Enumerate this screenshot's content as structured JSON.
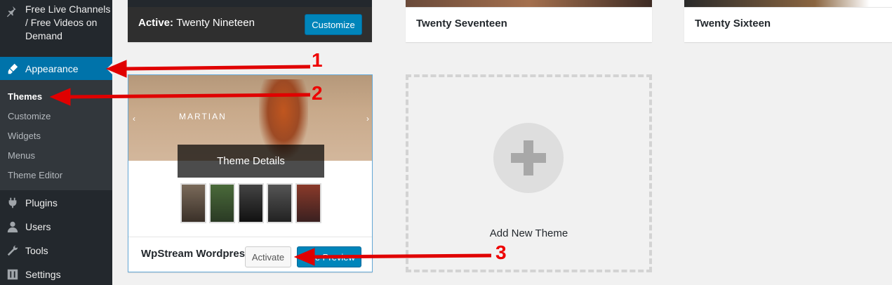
{
  "sidebar": {
    "items": [
      {
        "label": "Free Live Channels / Free Videos on Demand",
        "icon": "pushpin-icon"
      },
      {
        "label": "Appearance",
        "icon": "paintbrush-icon"
      },
      {
        "label": "Plugins",
        "icon": "plug-icon"
      },
      {
        "label": "Users",
        "icon": "user-icon"
      },
      {
        "label": "Tools",
        "icon": "wrench-icon"
      },
      {
        "label": "Settings",
        "icon": "settings-icon"
      }
    ],
    "submenu": [
      "Themes",
      "Customize",
      "Widgets",
      "Menus",
      "Theme Editor"
    ]
  },
  "themes": {
    "active": {
      "prefix": "Active:",
      "name": "Twenty Nineteen",
      "button": "Customize"
    },
    "twenty_seventeen": "Twenty Seventeen",
    "twenty_sixteen": "Twenty Sixteen",
    "wpstream": {
      "name": "WpStream Wordpress",
      "hero_title": "MARTIAN",
      "details": "Theme Details",
      "activate": "Activate",
      "preview": "Live Preview"
    },
    "add_new": "Add New Theme"
  },
  "annotations": [
    "1",
    "2",
    "3"
  ],
  "colors": {
    "sidebar": "#23282d",
    "accent": "#0073aa",
    "arrow": "#e00000"
  }
}
